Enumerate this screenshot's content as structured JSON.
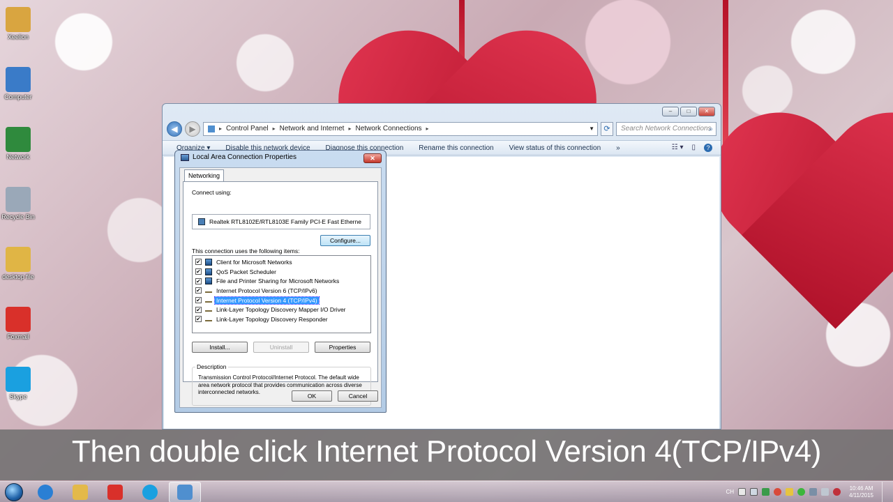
{
  "desktop_icons": [
    {
      "label": "Xeelion",
      "color": "#d9a540"
    },
    {
      "label": "Computer",
      "color": "#3a7bc8"
    },
    {
      "label": "Network",
      "color": "#2f8a3d"
    },
    {
      "label": "Recycle Bin",
      "color": "#9aa8b8"
    },
    {
      "label": "desktop file",
      "color": "#e0b545"
    },
    {
      "label": "Foxmail",
      "color": "#d9302a"
    },
    {
      "label": "Skype",
      "color": "#1aa0e0"
    }
  ],
  "explorer": {
    "breadcrumb": [
      "Control Panel",
      "Network and Internet",
      "Network Connections"
    ],
    "search_placeholder": "Search Network Connections",
    "commands": [
      "Organize ▾",
      "Disable this network device",
      "Diagnose this connection",
      "Rename this connection",
      "View status of this connection",
      "»"
    ],
    "window_buttons": [
      "–",
      "□",
      "✕"
    ]
  },
  "dialog": {
    "title": "Local Area Connection Properties",
    "close_label": "✕",
    "tab": "Networking",
    "connect_using_label": "Connect using:",
    "adapter": "Realtek RTL8102E/RTL8103E Family PCI-E Fast Etherne",
    "configure_button": "Configure...",
    "items_label": "This connection uses the following items:",
    "items": [
      {
        "label": "Client for Microsoft Networks",
        "checked": true,
        "icon": "net",
        "selected": false
      },
      {
        "label": "QoS Packet Scheduler",
        "checked": true,
        "icon": "net",
        "selected": false
      },
      {
        "label": "File and Printer Sharing for Microsoft Networks",
        "checked": true,
        "icon": "net",
        "selected": false
      },
      {
        "label": "Internet Protocol Version 6 (TCP/IPv6)",
        "checked": true,
        "icon": "proto",
        "selected": false
      },
      {
        "label": "Internet Protocol Version 4 (TCP/IPv4)",
        "checked": true,
        "icon": "proto",
        "selected": true
      },
      {
        "label": "Link-Layer Topology Discovery Mapper I/O Driver",
        "checked": true,
        "icon": "proto",
        "selected": false
      },
      {
        "label": "Link-Layer Topology Discovery Responder",
        "checked": true,
        "icon": "proto",
        "selected": false
      }
    ],
    "install_button": "Install...",
    "uninstall_button": "Uninstall",
    "properties_button": "Properties",
    "description_legend": "Description",
    "description": "Transmission Control Protocol/Internet Protocol. The default wide area network protocol that provides communication across diverse interconnected networks.",
    "ok_button": "OK",
    "cancel_button": "Cancel"
  },
  "caption": "Then double click Internet Protocol Version 4(TCP/IPv4)",
  "taskbar": {
    "pinned": [
      {
        "name": "internet-explorer",
        "color": "#2a7fd4"
      },
      {
        "name": "file-explorer",
        "color": "#e3b94a"
      },
      {
        "name": "foxmail",
        "color": "#d9302a"
      },
      {
        "name": "skype",
        "color": "#1aa0e0"
      },
      {
        "name": "control-panel",
        "color": "#4f8fcf"
      }
    ],
    "language": "CH",
    "time": "10:46 AM",
    "date": "4/11/2015"
  }
}
